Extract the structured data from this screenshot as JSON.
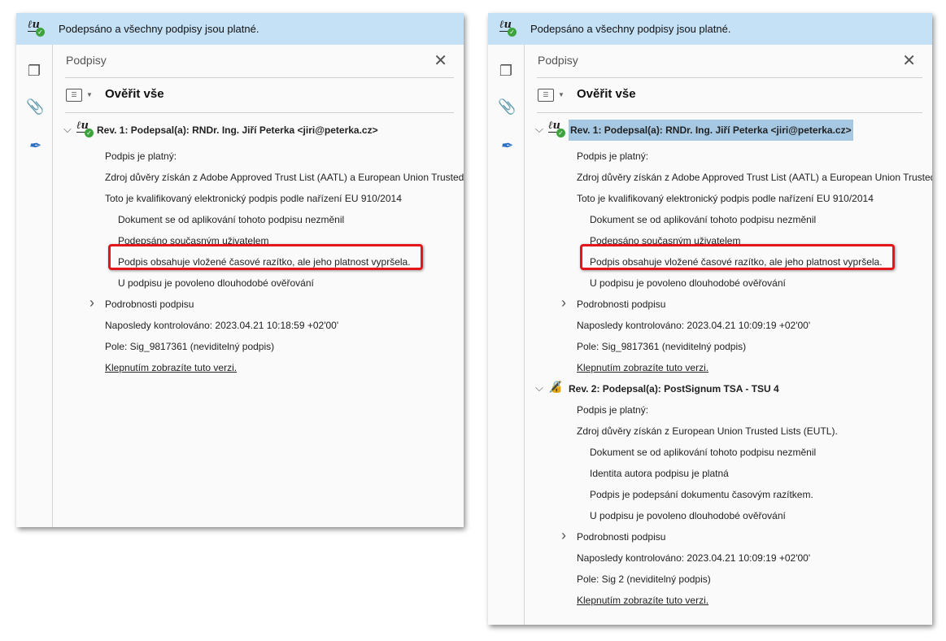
{
  "banner": {
    "text": "Podepsáno a všechny podpisy jsou platné."
  },
  "panel_title": "Podpisy",
  "verify_all": "Ověřit vše",
  "colors": {
    "banner": "#c5e1f6",
    "highlight": "#e4161b",
    "selection": "#a6c8e3"
  },
  "panels": [
    {
      "id": "p1",
      "rows": [
        {
          "type": "rev",
          "text": "Rev. 1: Podepsal(a): RNDr. Ing. Jiří Peterka <jiri@peterka.cz>",
          "icon": "signature-valid-icon",
          "selected": false
        },
        {
          "level": 1,
          "text": "Podpis je platný:"
        },
        {
          "level": 1,
          "text": "Zdroj důvěry získán z Adobe Approved Trust List (AATL) a European Union Trusted Lists (EUTL)."
        },
        {
          "level": 1,
          "text": "Toto je kvalifikovaný elektronický podpis podle nařízení EU 910/2014"
        },
        {
          "level": 2,
          "text": "Dokument se od aplikování tohoto podpisu nezměnil"
        },
        {
          "level": 2,
          "text": "Podepsáno současným uživatelem"
        },
        {
          "level": 2,
          "text": "Podpis obsahuje vložené časové razítko, ale jeho platnost vypršela.",
          "highlight": true
        },
        {
          "level": 2,
          "text": "U podpisu je povoleno dlouhodobé ověřování"
        },
        {
          "level": 1,
          "text": "Podrobnosti podpisu",
          "expander": true
        },
        {
          "level": 1,
          "text": "Naposledy kontrolováno: 2023.04.21 10:18:59 +02'00'"
        },
        {
          "level": 1,
          "text": "Pole: Sig_9817361 (neviditelný podpis)"
        },
        {
          "level": 1,
          "text": "Klepnutím zobrazíte tuto verzi.",
          "link": true
        }
      ]
    },
    {
      "id": "p2",
      "rows": [
        {
          "type": "rev",
          "text": "Rev. 1: Podepsal(a): RNDr. Ing. Jiří Peterka <jiri@peterka.cz>",
          "icon": "signature-valid-icon",
          "selected": true
        },
        {
          "level": 1,
          "text": "Podpis je platný:"
        },
        {
          "level": 1,
          "text": "Zdroj důvěry získán z Adobe Approved Trust List (AATL) a European Union Trusted Lists (EUTL)."
        },
        {
          "level": 1,
          "text": "Toto je kvalifikovaný elektronický podpis podle nařízení EU 910/2014"
        },
        {
          "level": 2,
          "text": "Dokument se od aplikování tohoto podpisu nezměnil"
        },
        {
          "level": 2,
          "text": "Podepsáno současným uživatelem"
        },
        {
          "level": 2,
          "text": "Podpis obsahuje vložené časové razítko, ale jeho platnost vypršela.",
          "highlight": true
        },
        {
          "level": 2,
          "text": "U podpisu je povoleno dlouhodobé ověřování"
        },
        {
          "level": 1,
          "text": "Podrobnosti podpisu",
          "expander": true
        },
        {
          "level": 1,
          "text": "Naposledy kontrolováno: 2023.04.21 10:09:19 +02'00'"
        },
        {
          "level": 1,
          "text": "Pole: Sig_9817361 (neviditelný podpis)"
        },
        {
          "level": 1,
          "text": "Klepnutím zobrazíte tuto verzi.",
          "link": true
        },
        {
          "type": "rev",
          "text": "Rev. 2: Podepsal(a): PostSignum TSA - TSU 4",
          "icon": "timestamp-valid-icon",
          "selected": false
        },
        {
          "level": 1,
          "text": "Podpis je platný:"
        },
        {
          "level": 1,
          "text": "Zdroj důvěry získán z European Union Trusted Lists (EUTL)."
        },
        {
          "level": 2,
          "text": "Dokument se od aplikování tohoto podpisu nezměnil"
        },
        {
          "level": 2,
          "text": "Identita autora podpisu je platná"
        },
        {
          "level": 2,
          "text": "Podpis je podepsání dokumentu časovým razítkem."
        },
        {
          "level": 2,
          "text": "U podpisu je povoleno dlouhodobé ověřování"
        },
        {
          "level": 1,
          "text": "Podrobnosti podpisu",
          "expander": true
        },
        {
          "level": 1,
          "text": "Naposledy kontrolováno: 2023.04.21 10:09:19 +02'00'"
        },
        {
          "level": 1,
          "text": "Pole: Sig 2 (neviditelný podpis)"
        },
        {
          "level": 1,
          "text": "Klepnutím zobrazíte tuto verzi.",
          "link": true
        }
      ]
    }
  ]
}
